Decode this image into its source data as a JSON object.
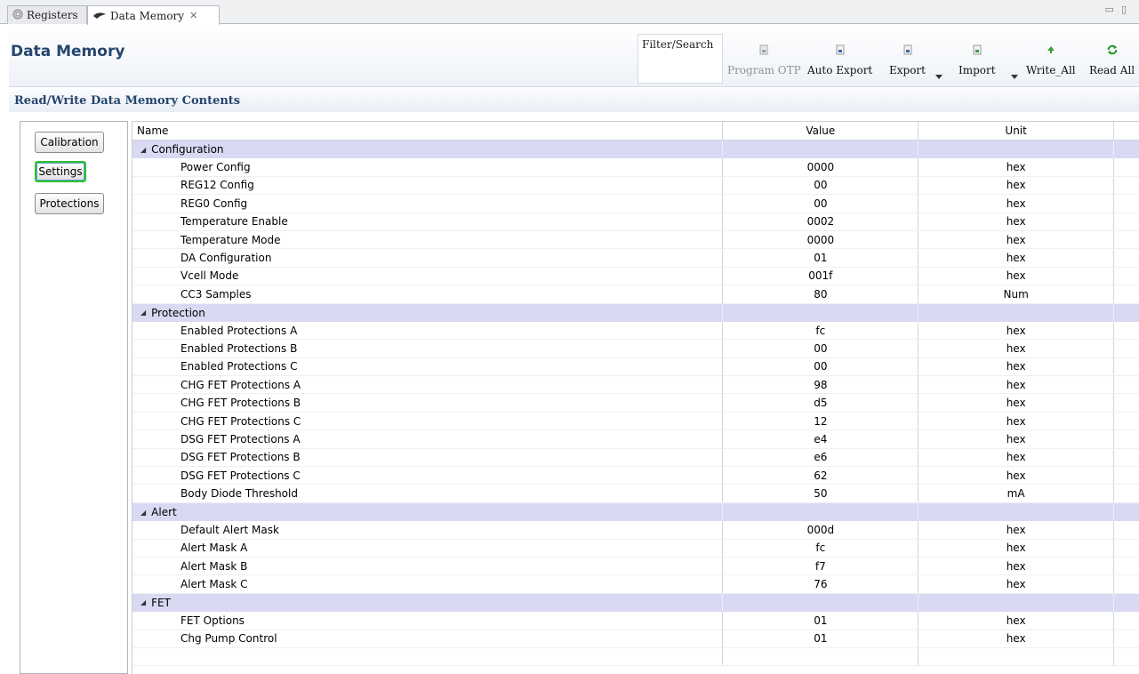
{
  "tabs": [
    {
      "label": "Registers",
      "icon": "registers-icon"
    },
    {
      "label": "Data Memory",
      "icon": "data-memory-icon"
    }
  ],
  "header": {
    "title": "Data Memory"
  },
  "filter": {
    "label": "Filter/Search"
  },
  "toolbar": {
    "program_otp": "Program OTP",
    "auto_export": "Auto Export",
    "export": "Export",
    "import": "Import",
    "write_all": "Write_All",
    "read_all": "Read All"
  },
  "section_heading": "Read/Write Data Memory Contents",
  "sidebar": {
    "buttons": [
      "Calibration",
      "Settings",
      "Protections"
    ],
    "selected": "Settings"
  },
  "table": {
    "columns": [
      "Name",
      "Value",
      "Unit"
    ],
    "groups": [
      {
        "name": "Configuration",
        "rows": [
          {
            "name": "Power Config",
            "value": "0000",
            "unit": "hex"
          },
          {
            "name": "REG12 Config",
            "value": "00",
            "unit": "hex"
          },
          {
            "name": "REG0 Config",
            "value": "00",
            "unit": "hex"
          },
          {
            "name": "Temperature Enable",
            "value": "0002",
            "unit": "hex"
          },
          {
            "name": "Temperature Mode",
            "value": "0000",
            "unit": "hex"
          },
          {
            "name": "DA Configuration",
            "value": "01",
            "unit": "hex"
          },
          {
            "name": "Vcell Mode",
            "value": "001f",
            "unit": "hex"
          },
          {
            "name": "CC3 Samples",
            "value": "80",
            "unit": "Num"
          }
        ]
      },
      {
        "name": "Protection",
        "rows": [
          {
            "name": "Enabled Protections A",
            "value": "fc",
            "unit": "hex"
          },
          {
            "name": "Enabled Protections B",
            "value": "00",
            "unit": "hex"
          },
          {
            "name": "Enabled Protections C",
            "value": "00",
            "unit": "hex"
          },
          {
            "name": "CHG FET Protections A",
            "value": "98",
            "unit": "hex"
          },
          {
            "name": "CHG FET Protections B",
            "value": "d5",
            "unit": "hex"
          },
          {
            "name": "CHG FET Protections C",
            "value": "12",
            "unit": "hex"
          },
          {
            "name": "DSG FET Protections A",
            "value": "e4",
            "unit": "hex"
          },
          {
            "name": "DSG FET Protections B",
            "value": "e6",
            "unit": "hex"
          },
          {
            "name": "DSG FET Protections C",
            "value": "62",
            "unit": "hex"
          },
          {
            "name": "Body Diode Threshold",
            "value": "50",
            "unit": "mA"
          }
        ]
      },
      {
        "name": "Alert",
        "rows": [
          {
            "name": "Default Alert Mask",
            "value": "000d",
            "unit": "hex"
          },
          {
            "name": "Alert Mask A",
            "value": "fc",
            "unit": "hex"
          },
          {
            "name": "Alert Mask B",
            "value": "f7",
            "unit": "hex"
          },
          {
            "name": "Alert Mask C",
            "value": "76",
            "unit": "hex"
          }
        ]
      },
      {
        "name": "FET",
        "rows": [
          {
            "name": "FET Options",
            "value": "01",
            "unit": "hex"
          },
          {
            "name": "Chg Pump Control",
            "value": "01",
            "unit": "hex"
          }
        ]
      }
    ]
  },
  "colors": {
    "title": "#26466d",
    "category_row": "#d9d9f3",
    "selected_outline": "#29c52a",
    "refresh_icon": "#2a9a2a"
  }
}
